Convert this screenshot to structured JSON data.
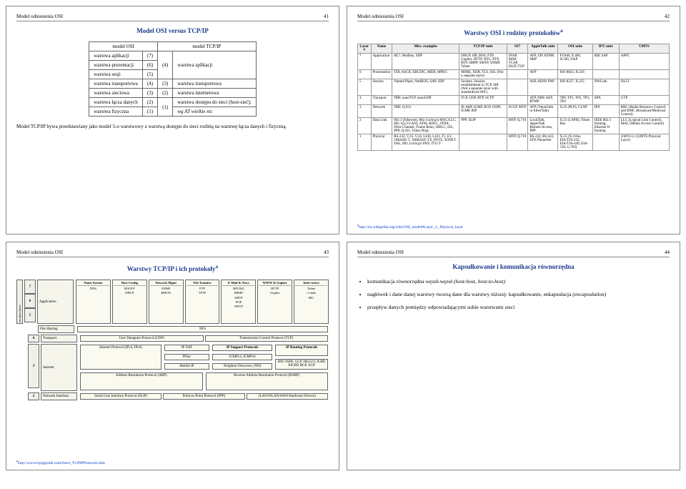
{
  "slides": {
    "s41": {
      "header_left": "Model odniesienia OSI",
      "header_right": "41",
      "title": "Model OSI versus TCP/IP",
      "col_osi": "model OSI",
      "col_tcpip": "model TCP/IP",
      "rows": [
        [
          "warstwa aplikacji",
          "(7)",
          "",
          ""
        ],
        [
          "warstwa prezentacji",
          "(6)",
          "(4)",
          "warstwa aplikacji"
        ],
        [
          "warstwa sesji",
          "(5)",
          "",
          ""
        ],
        [
          "warstwa transportowa",
          "(4)",
          "(3)",
          "warstwa transportowa"
        ],
        [
          "warstwa sieciowa",
          "(3)",
          "(2)",
          "warstwa internetowa"
        ],
        [
          "warstwa łącza danych",
          "(2)",
          "(1)",
          "warstwa dostępu do sieci (host-sieć);"
        ],
        [
          "warstwa fizyczna",
          "(1)",
          "",
          "wg AT wielkie nic"
        ]
      ],
      "note": "Model TCP/IP bywa przedstawiany jako model 5-o warstwowy z warstwą dostępu do sieci rozbitą na warstwę łącza danych i fizyczną."
    },
    "s42": {
      "header_left": "Model odniesienia OSI",
      "header_right": "42",
      "title": "Warstwy OSI i rodziny protokołów",
      "title_sup": "a",
      "cols": [
        "Layer #",
        "Name",
        "Misc. examples",
        "TCP/IP suite",
        "SS7",
        "AppleTalk suite",
        "OSI suite",
        "IPX suite",
        "UMTS"
      ],
      "rows": [
        [
          "7",
          "Application",
          "HL7, Modbus, SDP",
          "DHCP, SIP, DNS, FTP, Gopher, HTTP, NFS, NTP, RTP, SMPP, SMTP, SNMP, Telnet",
          "INAP, MAP, TCAP, ISUP, TUP",
          "AFP, ZIP, RTMP, NBP",
          "FTAM, X.400, X.500, DAP",
          "RIP, SAP",
          "APPC"
        ],
        [
          "6",
          "Presentation",
          "TDI, ASCII, EBCDIC, MIDI, MPEG",
          "MIME, XDR, TLS, SSL (Not a separate layer)",
          "",
          "AFP",
          "ISO 8823, X.226",
          "",
          ""
        ],
        [
          "5",
          "Session",
          "Named Pipes, NetBIOS, SAP, SDP",
          "Sockets. Session establishment in TCP, SIP. (Not a separate layer with standardized API.)",
          "",
          "ASP, ADSP, PAP",
          "ISO 8327, X.225",
          "NWLink",
          "DLCI"
        ],
        [
          "4",
          "Transport",
          "NBF, nanoTCP, nanoUDP",
          "TCP, UDP, RTP, SCTP",
          "",
          "ATP, NBP, AEP, RTMP",
          "TP0, TP1, TP2, TP3, TP4",
          "SPX",
          "GTP"
        ],
        [
          "3",
          "Network",
          "NBF, Q.931",
          "IP, ARP, ICMP, BGP, OSPF, IGMP, RIP",
          "SCCP, MTP",
          "ATP (TokenTalk or EtherTalk)",
          "X.25 (PLP), CLNP",
          "IPX",
          "RRC (Radio Resource Control) and BMC (Broadcast/Multicast Control)"
        ],
        [
          "2",
          "Data Link",
          "802.3 (Ethernet), 802.11a/b/g/n MAC/LLC, 802.1Q (VLAN), ATM, HDLC, FDDI, Fibre Channel, Frame Relay, HDLC, ISL, PPP, Q.921, Token Ring",
          "PPP, SLIP",
          "MTP, Q.710",
          "LocalTalk, AppleTalk Remote Access, PPP",
          "X.25 (LAPB), Token Bus",
          "IEEE 802.3 framing, Ethernet II framing",
          "LLC (Logical Link Control), MAC (Media Access Control)"
        ],
        [
          "1",
          "Physical",
          "RS-232, V.35, V.34, I.430, I.431, T1, E1, 10BASE-T, 100BASE-TX, POTS, SONET, DSL, 802.11a/b/g/n PHY, ITU-T",
          "",
          "MTP, Q.710",
          "RS-232, RS-422, STP, PhoneNet",
          "X.25 (X.21bis, EIA/TIA-232, EIA/TIA-449, EIA-530, G.703)",
          "",
          "UMTS L1 (UMTS Physical Layer)"
        ]
      ],
      "footnote_label": "a",
      "footnote": "http://en.wikipedia.org/wiki/OSI_model#Layer_1:_Physical_layer"
    },
    "s43": {
      "header_left": "Model odniesienia OSI",
      "header_right": "43",
      "title": "Warstwy TCP/IP i ich protokoły",
      "title_sup": "a",
      "side_labels": [
        "7",
        "6",
        "5"
      ],
      "side_group": "Application",
      "side_encaps": "encapsulation",
      "app_cols": [
        {
          "label": "Name System",
          "items": [
            "DNS"
          ]
        },
        {
          "label": "Host Config",
          "items": [
            "BOOTP",
            "DHCP"
          ]
        },
        {
          "label": "Network Mgmt",
          "items": [
            "SNMP",
            "RMON"
          ]
        },
        {
          "label": "File Transfer",
          "items": [
            "FTP",
            "TFTP"
          ]
        },
        {
          "label": "E-Mail & News",
          "items": [
            "RFC822",
            "MIME",
            "SMTP",
            "POP",
            "NNTP"
          ]
        },
        {
          "label": "WWW & Gopher",
          "items": [
            "HTTP",
            "Gopher"
          ]
        },
        {
          "label": "Inter-active",
          "items": [
            "Telnet",
            "r Cmds",
            "IRC"
          ]
        }
      ],
      "row5": {
        "label": "File Sharing",
        "item": "NFS"
      },
      "layer4": {
        "num": "4",
        "name": "Transport",
        "left": "User Datagram Protocol (UDP)",
        "right": "Transmission Control Protocol (TCP)"
      },
      "layer3": {
        "num": "3",
        "name": "Internet",
        "ip": "Internet Protocol (IPv4, IPv6)",
        "nat": "IP NAT",
        "ipsec": "IPSec",
        "mobile": "Mobile IP",
        "support": "IP Support Protocols",
        "icmp": "ICMPv4, ICMPv6",
        "nd": "Neighbor Discovery (ND)",
        "routing": "IP Routing Protocols",
        "routing_items": "RIP, OSPF, GGP, HELLO, IGRP, EIGRP, BGP, EGP",
        "arp": "Address Resolution Protocol (ARP)",
        "rarp": "Reverse Address Resolution Protocol (RARP)"
      },
      "layer2": {
        "num": "2",
        "name": "Network Interface",
        "slip": "Serial Line Interface Protocol (SLIP)",
        "ppp": "Point-to-Point Protocol (PPP)",
        "hw": "(LAN/WLAN/WAN Hardware Drivers)"
      },
      "footnote_label": "a",
      "footnote": "http://www.tcpipguide.com/free/t_TCPIPProtocols.htm"
    },
    "s44": {
      "header_left": "Model odniesienia OSI",
      "header_right": "44",
      "title": "Kapsułkowanie i komunikacja równorzędna",
      "bullets": [
        {
          "text": "komunikacja równorzędna węzeł-węzeł ",
          "italic": "(host-host, host-to-host)"
        },
        {
          "text": "nagłówek i dane danej warstwy tworzą dane dla warstwy niższej: kapsułkowanie, enkapsulacja ",
          "italic": "(encapsulation)"
        },
        {
          "text": "przepływ danych pomiędzy odpowiadającymi sobie warstwami sieci",
          "italic": ""
        }
      ]
    }
  }
}
